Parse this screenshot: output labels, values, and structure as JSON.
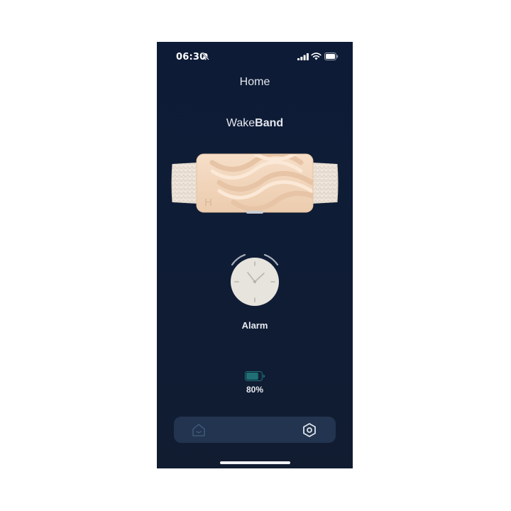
{
  "status_bar": {
    "time": "06:30",
    "bell_icon": "bell-slash-icon",
    "signal_icon": "cellular-signal-icon",
    "wifi_icon": "wifi-icon",
    "battery_icon": "battery-icon"
  },
  "header": {
    "title": "Home"
  },
  "device": {
    "brand_regular": "Wake",
    "brand_bold": "Band",
    "image_icon": "wristband-device-image",
    "logo_letter": "H"
  },
  "alarm": {
    "label": "Alarm",
    "icon": "clock-icon"
  },
  "battery": {
    "percent": "80%",
    "level": 0.8,
    "icon": "battery-level-icon",
    "fill_color": "#1f6f74"
  },
  "tab_bar": {
    "home_icon": "home-icon",
    "settings_icon": "settings-hexagon-icon"
  },
  "colors": {
    "background": "#0d1b36",
    "tab_bar": "#22344f",
    "band": "#f1d7bf"
  }
}
